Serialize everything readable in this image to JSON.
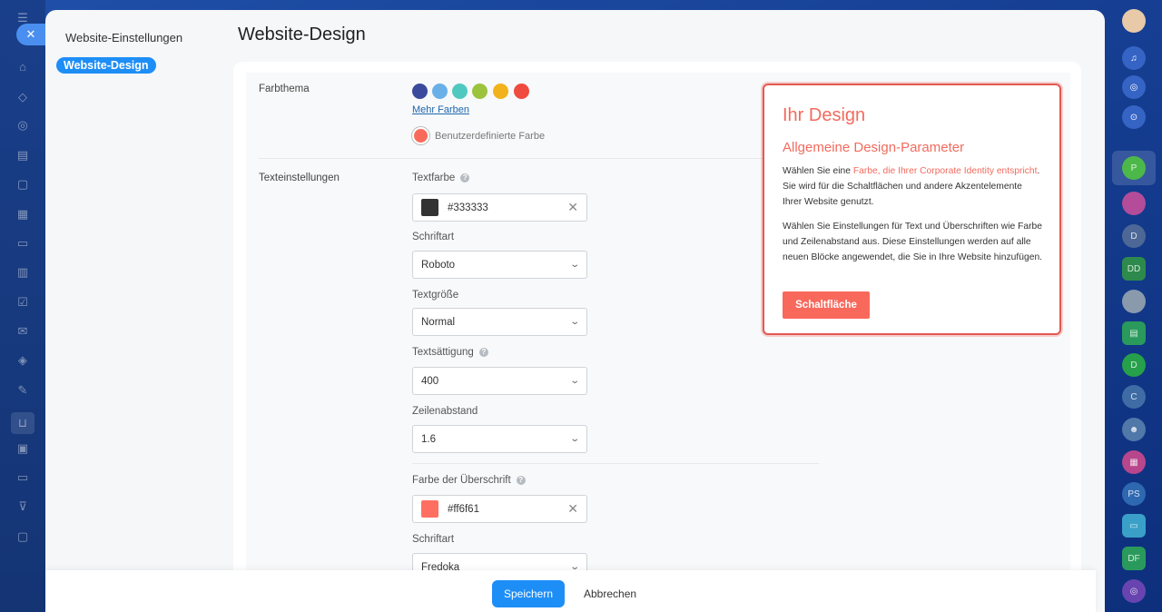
{
  "nav": {
    "settings_link": "Website-Einstellungen",
    "active_item": "Website-Design"
  },
  "page": {
    "title": "Website-Design"
  },
  "color_theme": {
    "label": "Farbthema",
    "swatches": [
      "#3b4a9c",
      "#6ab0e8",
      "#4fc9c0",
      "#9cc33d",
      "#f2b21b",
      "#ef4b3f"
    ],
    "more_colors": "Mehr Farben",
    "custom_color": "Benutzerdefinierte Farbe"
  },
  "text_settings": {
    "label": "Texteinstellungen",
    "text_color_label": "Textfarbe",
    "text_color_value": "#333333",
    "font_label": "Schriftart",
    "font_value": "Roboto",
    "size_label": "Textgröße",
    "size_value": "Normal",
    "weight_label": "Textsättigung",
    "weight_value": "400",
    "line_height_label": "Zeilenabstand",
    "line_height_value": "1.6",
    "heading_color_label": "Farbe der Überschrift",
    "heading_color_value": "#ff6f61",
    "heading_font_label": "Schriftart",
    "heading_font_value": "Fredoka"
  },
  "preview": {
    "title": "Ihr Design",
    "subtitle": "Allgemeine Design-Parameter",
    "p1_start": "Wählen Sie eine ",
    "p1_link": "Farbe, die Ihrer Corporate Identity entspricht",
    "p1_end": ". Sie wird für die Schaltflächen und andere Akzentelemente Ihrer Website genutzt.",
    "p2": "Wählen Sie Einstellungen für Text und Überschriften wie Farbe und Zeilenabstand aus. Diese Einstellungen werden auf alle neuen Blöcke angewendet, die Sie in Ihre Website hinzufügen.",
    "button": "Schaltfläche"
  },
  "footer": {
    "save": "Speichern",
    "cancel": "Abbrechen"
  },
  "icons": {
    "text_color_help": "?",
    "weight_help": "?",
    "heading_color_help": "?",
    "clear": "✕",
    "chevron": "⌄",
    "close": "✕"
  },
  "right_rail": [
    "P",
    "D",
    "DD",
    "D",
    "C",
    "PS",
    "DF"
  ]
}
